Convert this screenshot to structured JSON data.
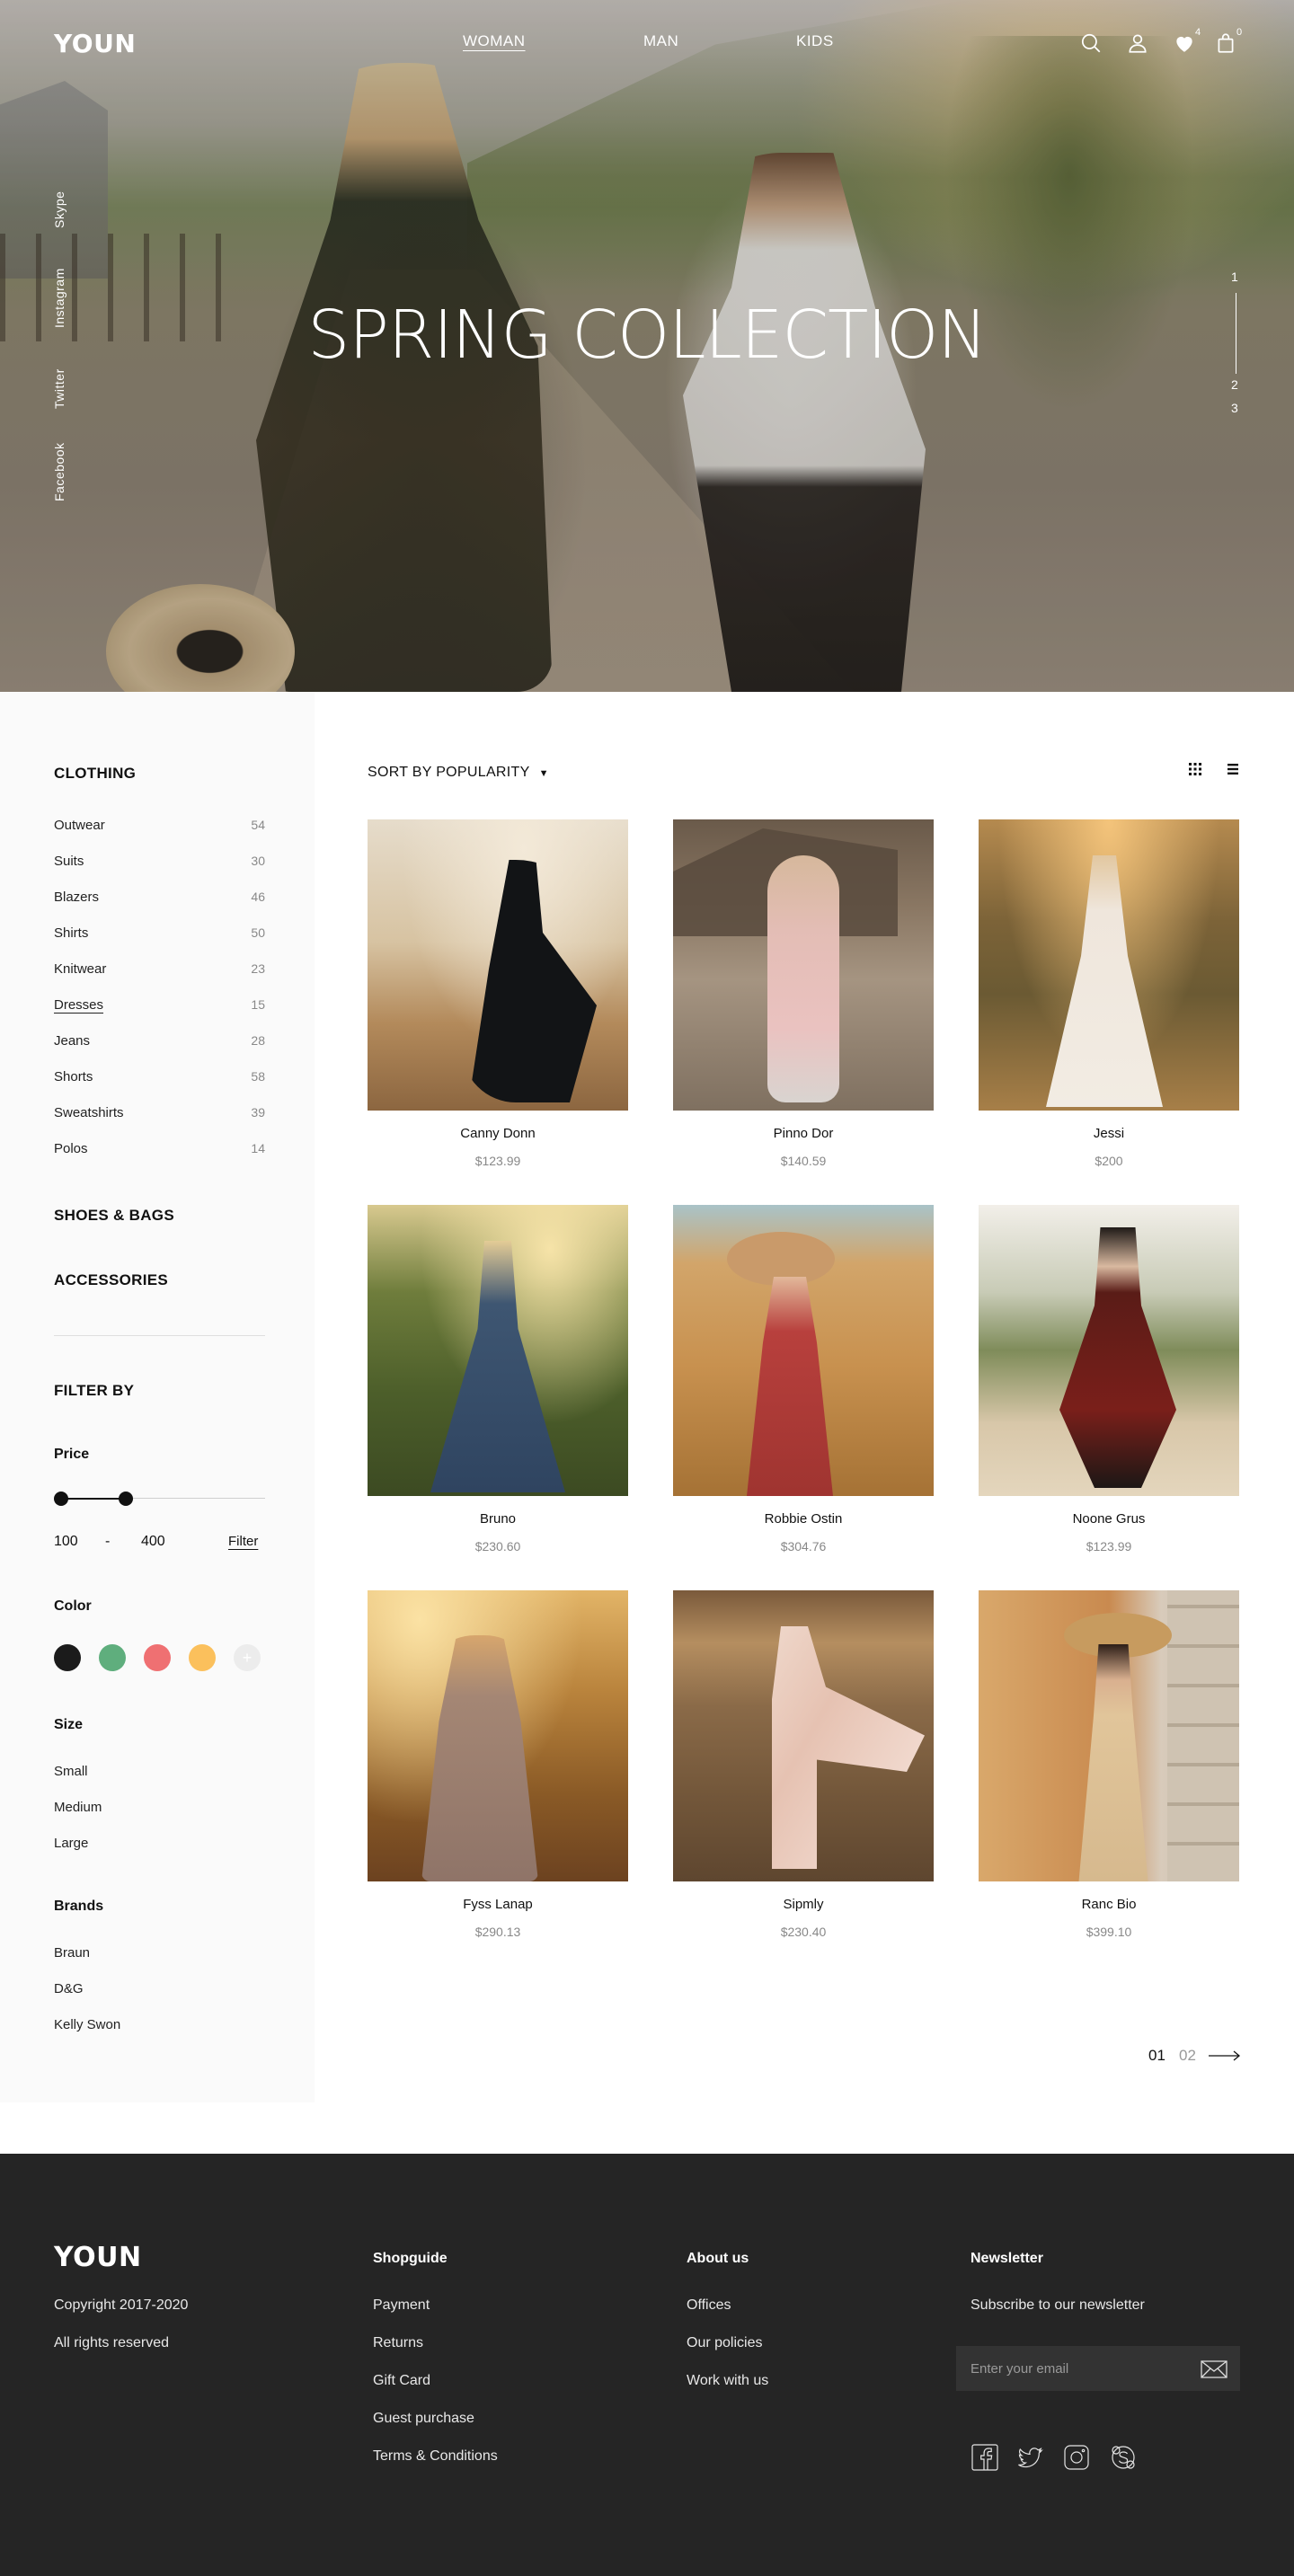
{
  "brand": {
    "logo": "YOUN"
  },
  "nav": {
    "items": [
      {
        "label": "WOMAN",
        "active": true
      },
      {
        "label": "MAN"
      },
      {
        "label": "KIDS"
      }
    ]
  },
  "header_icons": {
    "search": "search-icon",
    "account": "user-icon",
    "wishlist": "heart-icon",
    "wishlist_count": "4",
    "cart": "bag-icon",
    "cart_count": "0"
  },
  "hero": {
    "title": "SPRING COLLECTION",
    "social": [
      "Skype",
      "Instagram",
      "Twitter",
      "Facebook"
    ],
    "slides": [
      "1",
      "2",
      "3"
    ]
  },
  "sidebar": {
    "clothing_heading": "CLOTHING",
    "categories": [
      {
        "label": "Outwear",
        "count": "54"
      },
      {
        "label": "Suits",
        "count": "30"
      },
      {
        "label": "Blazers",
        "count": "46"
      },
      {
        "label": "Shirts",
        "count": "50"
      },
      {
        "label": "Knitwear",
        "count": "23"
      },
      {
        "label": "Dresses",
        "count": "15",
        "active": true
      },
      {
        "label": "Jeans",
        "count": "28"
      },
      {
        "label": "Shorts",
        "count": "58"
      },
      {
        "label": "Sweatshirts",
        "count": "39"
      },
      {
        "label": "Polos",
        "count": "14"
      }
    ],
    "shoes_heading": "SHOES & BAGS",
    "accessories_heading": "ACCESSORIES",
    "filter_heading": "FILTER BY",
    "price": {
      "label": "Price",
      "min": "100",
      "dash": "-",
      "max": "400",
      "filter_label": "Filter"
    },
    "color": {
      "label": "Color",
      "swatches": [
        "#1b1b1b",
        "#5fae7d",
        "#ef7072",
        "#fbc05c"
      ],
      "more_icon": "plus-icon"
    },
    "size": {
      "label": "Size",
      "options": [
        "Small",
        "Medium",
        "Large"
      ]
    },
    "brands": {
      "label": "Brands",
      "options": [
        "Braun",
        "D&G",
        "Kelly Swon"
      ]
    }
  },
  "toolbar": {
    "sort_label": "SORT BY POPULARITY",
    "grid_view_icon": "grid-icon",
    "list_view_icon": "list-icon"
  },
  "products": [
    {
      "name": "Canny Donn",
      "price": "$123.99"
    },
    {
      "name": "Pinno Dor",
      "price": "$140.59"
    },
    {
      "name": "Jessi",
      "price": "$200"
    },
    {
      "name": "Bruno",
      "price": "$230.60"
    },
    {
      "name": "Robbie Ostin",
      "price": "$304.76"
    },
    {
      "name": "Noone Grus",
      "price": "$123.99"
    },
    {
      "name": "Fyss  Lanap",
      "price": "$290.13"
    },
    {
      "name": "Sipmly",
      "price": "$230.40"
    },
    {
      "name": "Ranc Bio",
      "price": "$399.10"
    }
  ],
  "pagination": {
    "pages": [
      "01",
      "02"
    ],
    "current": "01",
    "next_icon": "arrow-right-icon"
  },
  "footer": {
    "logo": "YOUN",
    "copyright": "Copyright 2017-2020",
    "rights": "All rights reserved",
    "shopguide": {
      "heading": "Shopguide",
      "links": [
        "Payment",
        "Returns",
        "Gift Card",
        "Guest purchase",
        "Terms & Conditions"
      ]
    },
    "about": {
      "heading": "About us",
      "links": [
        "Offices",
        "Our policies",
        "Work with us"
      ]
    },
    "newsletter": {
      "heading": "Newsletter",
      "text": "Subscribe to our newsletter",
      "placeholder": "Enter your email",
      "send_icon": "envelope-icon"
    },
    "social_icons": [
      "facebook-icon",
      "twitter-icon",
      "instagram-icon",
      "skype-icon"
    ]
  }
}
